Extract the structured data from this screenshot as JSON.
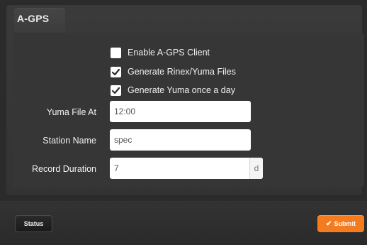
{
  "panel": {
    "title": "A-GPS"
  },
  "options": [
    {
      "label": "Enable A-GPS Client",
      "checked": false
    },
    {
      "label": "Generate Rinex/Yuma Files",
      "checked": true
    },
    {
      "label": "Generate Yuma once a day",
      "checked": true
    }
  ],
  "fields": {
    "yuma_file_at": {
      "label": "Yuma File At",
      "value": "12:00"
    },
    "station_name": {
      "label": "Station Name",
      "value": "spec"
    },
    "record_duration": {
      "label": "Record Duration",
      "value": "7",
      "unit": "d"
    }
  },
  "footer": {
    "status_label": "Status",
    "submit_label": "Submit"
  },
  "colors": {
    "submit_orange": "#f47c20",
    "check_mark": "#2b2b2b"
  }
}
